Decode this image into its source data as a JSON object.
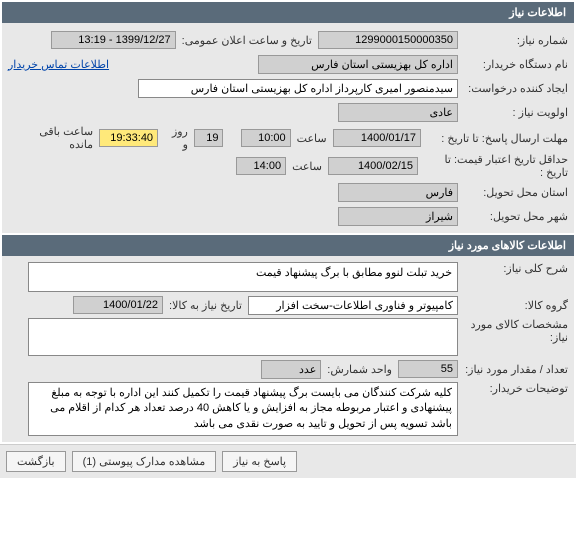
{
  "panel1": {
    "title": "اطلاعات نیاز",
    "need_number_label": "شماره نیاز:",
    "need_number": "1299000150000350",
    "public_announce_label": "تاریخ و ساعت اعلان عمومی:",
    "public_announce": "1399/12/27 - 13:19",
    "buyer_org_label": "نام دستگاه خریدار:",
    "buyer_org": "اداره کل بهزیستی استان فارس",
    "contact_link": "اطلاعات تماس خریدار",
    "creator_label": "ایجاد کننده درخواست:",
    "creator": "سیدمنصور امیری کارپرداز اداره کل بهزیستی استان فارس",
    "priority_label": "اولویت نیاز :",
    "priority": "عادی",
    "deadline_label": "مهلت ارسال پاسخ:",
    "until_date_label": "تا تاریخ :",
    "deadline_date": "1400/01/17",
    "time_label": "ساعت",
    "deadline_time": "10:00",
    "days_value": "19",
    "days_label": "روز و",
    "remaining_time": "19:33:40",
    "remaining_label": "ساعت باقی مانده",
    "min_credit_label": "حداقل تاریخ اعتبار قیمت:",
    "min_credit_date": "1400/02/15",
    "min_credit_time": "14:00",
    "province_label": "استان محل تحویل:",
    "province": "فارس",
    "city_label": "شهر محل تحویل:",
    "city": "شیراز"
  },
  "panel2": {
    "title": "اطلاعات کالاهای مورد نیاز",
    "need_desc_label": "شرح کلی نیاز:",
    "need_desc": "خرید تبلت لنوو مطابق با برگ پیشنهاد قیمت",
    "category_label": "گروه کالا:",
    "category": "کامپیوتر و فناوری اطلاعات-سخت افزار",
    "need_until_label": "تاریخ نیاز به کالا:",
    "need_until": "1400/01/22",
    "spec_label": "مشخصات کالای مورد نیاز:",
    "spec": "",
    "qty_label": "تعداد / مقدار مورد نیاز:",
    "qty": "55",
    "unit_label": "واحد شمارش:",
    "unit": "عدد",
    "buyer_note_label": "توضیحات خریدار:",
    "buyer_note": "کلیه شرکت کنندگان می بایست برگ پیشنهاد قیمت را تکمیل کنند این اداره با توجه به مبلغ پیشنهادی و اعتبار مربوطه مجاز به افزایش و یا کاهش 40 درصد تعداد هر کدام از اقلام می باشد تسویه پس از تحویل  و تایید به صورت نقدی می باشد"
  },
  "buttons": {
    "reply": "پاسخ به نیاز",
    "attachments": "مشاهده مدارک پیوستی (1)",
    "return": "بازگشت"
  }
}
